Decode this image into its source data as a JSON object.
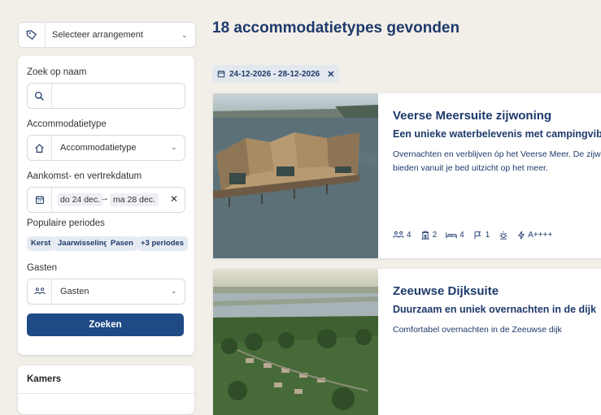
{
  "arrangement_select": {
    "label": "Selecteer arrangement",
    "icon": "tag-icon"
  },
  "filters": {
    "name_label": "Zoek op naam",
    "name_value": "",
    "type_label": "Accommodatietype",
    "type_value": "Accommodatietype",
    "date_label": "Aankomst- en vertrekdatum",
    "date_from": "do 24 dec.",
    "date_arrow": "→",
    "date_to": "ma 28 dec.",
    "clear_symbol": "✕",
    "periods_label": "Populaire periodes",
    "periods": [
      "Kerst",
      "Jaarwisseling",
      "Pasen",
      "+3 periodes"
    ],
    "guests_label": "Gasten",
    "guests_value": "Gasten",
    "search_button": "Zoeken"
  },
  "rooms": {
    "title": "Kamers"
  },
  "results": {
    "heading": "18 accommodatietypes gevonden",
    "date_filter": "24-12-2026 - 28-12-2026",
    "date_filter_clear": "✕",
    "items": [
      {
        "title": "Veerse Meersuite zijwoning",
        "subtitle": "Een unieke waterbelevenis met campingvib",
        "description": "Overnachten en verblijven óp het Veerse Meer. De zijwon bieden vanuit je bed uitzicht op het meer.",
        "features": [
          {
            "icon": "persons-icon",
            "value": "4"
          },
          {
            "icon": "rooms-icon",
            "value": "2"
          },
          {
            "icon": "bed-icon",
            "value": "4"
          },
          {
            "icon": "pet-icon",
            "value": "1"
          },
          {
            "icon": "sun-icon",
            "value": ""
          },
          {
            "icon": "energy-label-icon",
            "value": "A++++"
          }
        ]
      },
      {
        "title": "Zeeuwse Dijksuite",
        "subtitle": "Duurzaam en uniek overnachten in de dijk",
        "description": "Comfortabel overnachten in de Zeeuwse dijk"
      }
    ]
  },
  "colors": {
    "brand": "#1e3a6b",
    "button": "#1f4a86",
    "background": "#f2efe9"
  }
}
